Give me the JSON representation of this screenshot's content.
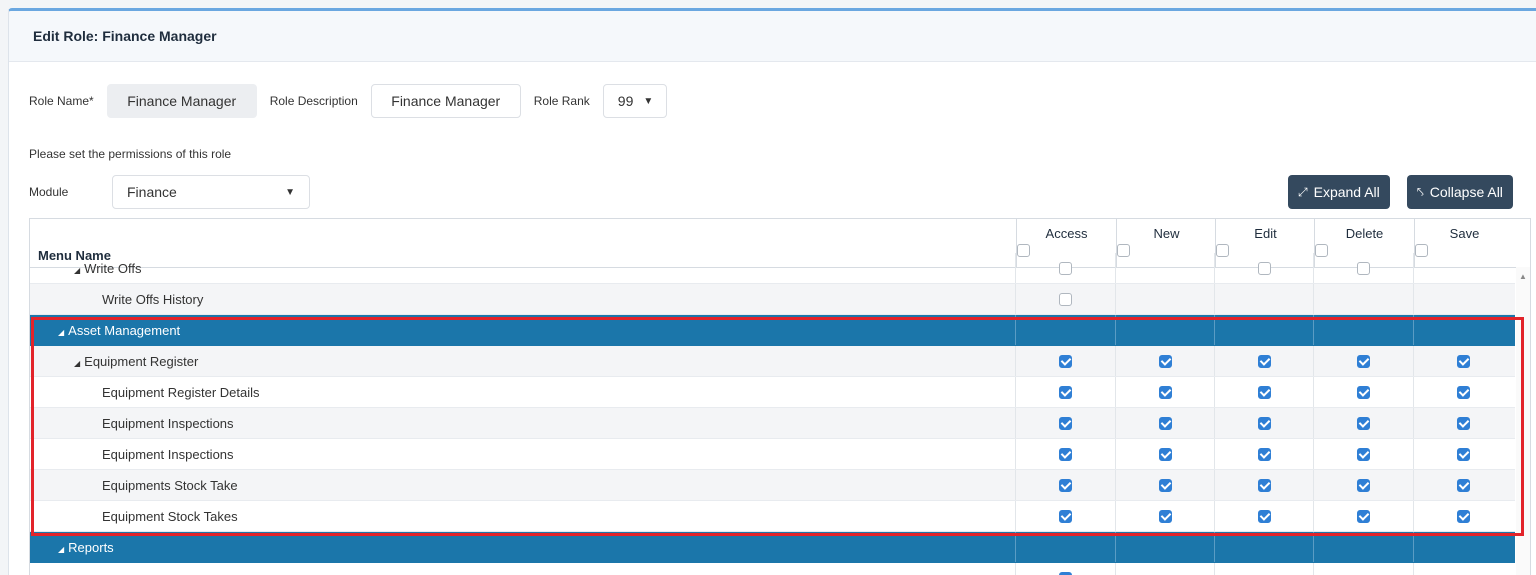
{
  "header": {
    "title": "Edit Role: Finance Manager"
  },
  "form": {
    "role_name_label": "Role Name*",
    "role_name_value": "Finance Manager",
    "role_description_label": "Role Description",
    "role_description_value": "Finance Manager",
    "role_rank_label": "Role Rank",
    "role_rank_value": "99"
  },
  "hint": "Please set the permissions of this role",
  "module": {
    "label": "Module",
    "value": "Finance"
  },
  "buttons": {
    "expand_all": "Expand All",
    "collapse_all": "Collapse All"
  },
  "grid": {
    "menu_name_header": "Menu Name",
    "columns": [
      "Access",
      "New",
      "Edit",
      "Delete",
      "Save"
    ],
    "rows": [
      {
        "name": "Write Offs",
        "level": 1,
        "type": "item",
        "expander": true,
        "checks": [
          "off",
          "none",
          "off",
          "off",
          "none"
        ]
      },
      {
        "name": "Write Offs History",
        "level": 2,
        "type": "item",
        "checks": [
          "off",
          "none",
          "none",
          "none",
          "none"
        ]
      },
      {
        "name": "Asset Management",
        "level": 0,
        "type": "group",
        "expander": true,
        "checks": [
          "none",
          "none",
          "none",
          "none",
          "none"
        ]
      },
      {
        "name": "Equipment Register",
        "level": 1,
        "type": "item",
        "expander": true,
        "checks": [
          "on",
          "on",
          "on",
          "on",
          "on"
        ]
      },
      {
        "name": "Equipment Register Details",
        "level": 2,
        "type": "item",
        "checks": [
          "on",
          "on",
          "on",
          "on",
          "on"
        ]
      },
      {
        "name": "Equipment Inspections",
        "level": 2,
        "type": "item",
        "checks": [
          "on",
          "on",
          "on",
          "on",
          "on"
        ]
      },
      {
        "name": "Equipment Inspections",
        "level": 2,
        "type": "item",
        "checks": [
          "on",
          "on",
          "on",
          "on",
          "on"
        ]
      },
      {
        "name": "Equipments Stock Take",
        "level": 2,
        "type": "item",
        "checks": [
          "on",
          "on",
          "on",
          "on",
          "on"
        ]
      },
      {
        "name": "Equipment Stock Takes",
        "level": 2,
        "type": "item",
        "checks": [
          "on",
          "on",
          "on",
          "on",
          "on"
        ]
      },
      {
        "name": "Reports",
        "level": 0,
        "type": "group",
        "expander": true,
        "checks": [
          "none",
          "none",
          "none",
          "none",
          "none"
        ]
      },
      {
        "name": "",
        "level": 2,
        "type": "item",
        "checks": [
          "on",
          "none",
          "none",
          "none",
          "none"
        ]
      }
    ]
  },
  "colors": {
    "group_row": "#1b76aa",
    "button": "#34495e",
    "highlight": "#e2232a",
    "checkbox_on": "#2f7fd5"
  }
}
